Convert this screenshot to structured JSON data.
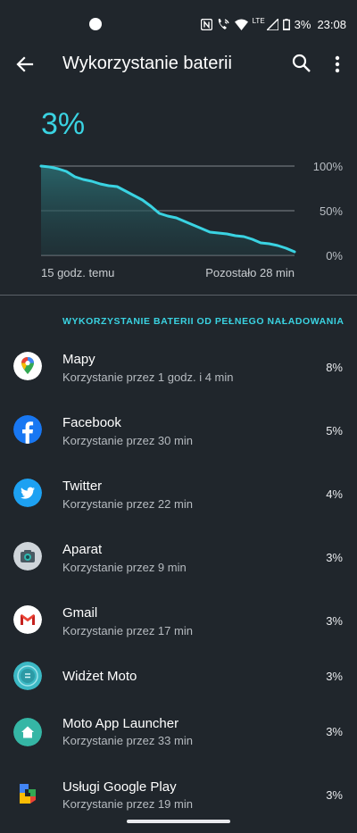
{
  "status_bar": {
    "lte_label": "LTE",
    "battery_text": "3%",
    "time": "23:08"
  },
  "header": {
    "title": "Wykorzystanie baterii",
    "back_icon": "arrow-back-icon",
    "search_icon": "search-icon",
    "more_icon": "more-vert-icon"
  },
  "battery": {
    "level": "3%",
    "time_ago": "15 godz. temu",
    "remaining": "Pozostało 28 min",
    "accent_color": "#3ad3e2"
  },
  "chart_data": {
    "type": "area",
    "y_ticks": [
      "100%",
      "50%",
      "0%"
    ],
    "ylim": [
      0,
      100
    ],
    "x": [
      0,
      0.5,
      1,
      1.5,
      2,
      2.5,
      3,
      3.5,
      4,
      4.5,
      5,
      5.5,
      6,
      6.5,
      7,
      7.5,
      8,
      8.5,
      9,
      9.5,
      10,
      10.5,
      11,
      11.5,
      12,
      12.5,
      13,
      13.5,
      14,
      14.5,
      15
    ],
    "values": [
      100,
      99,
      97,
      94,
      88,
      85,
      83,
      80,
      78,
      77,
      72,
      67,
      62,
      55,
      47,
      44,
      42,
      38,
      34,
      30,
      26,
      25,
      24,
      22,
      21,
      18,
      14,
      13,
      11,
      8,
      4
    ],
    "grid": true
  },
  "usage_section": {
    "title": "WYKORZYSTANIE BATERII OD PEŁNEGO NAŁADOWANIA",
    "apps": [
      {
        "name": "Mapy",
        "usage": "Korzystanie przez 1 godz. i 4 min",
        "percent": "8%",
        "icon": "maps-icon"
      },
      {
        "name": "Facebook",
        "usage": "Korzystanie przez 30 min",
        "percent": "5%",
        "icon": "facebook-icon"
      },
      {
        "name": "Twitter",
        "usage": "Korzystanie przez 22 min",
        "percent": "4%",
        "icon": "twitter-icon"
      },
      {
        "name": "Aparat",
        "usage": "Korzystanie przez 9 min",
        "percent": "3%",
        "icon": "camera-icon"
      },
      {
        "name": "Gmail",
        "usage": "Korzystanie przez 17 min",
        "percent": "3%",
        "icon": "gmail-icon"
      },
      {
        "name": "Widżet Moto",
        "usage": "",
        "percent": "3%",
        "icon": "moto-widget-icon"
      },
      {
        "name": "Moto App Launcher",
        "usage": "Korzystanie przez 33 min",
        "percent": "3%",
        "icon": "launcher-home-icon"
      },
      {
        "name": "Usługi Google Play",
        "usage": "Korzystanie przez 19 min",
        "percent": "3%",
        "icon": "google-play-services-icon"
      }
    ]
  }
}
